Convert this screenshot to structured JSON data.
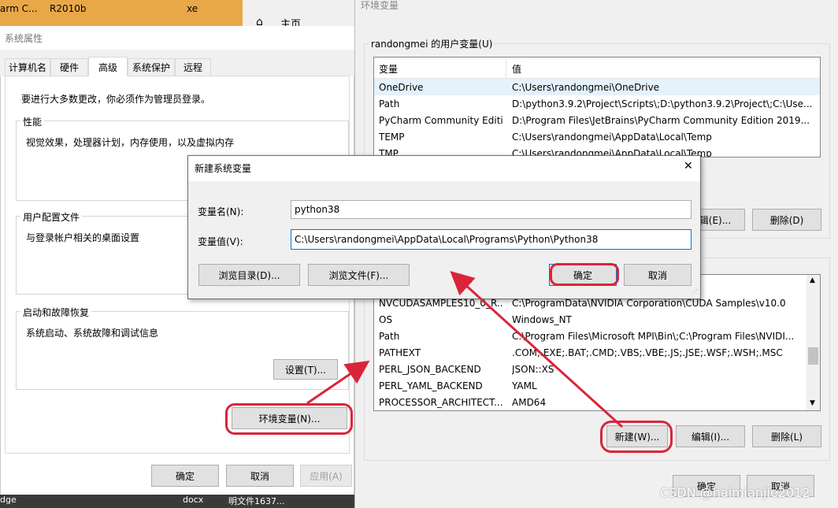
{
  "taskbar_top": {
    "item1": "arm C...",
    "item2": "R2010b",
    "item3": "xe",
    "item4": "主页"
  },
  "sys_props": {
    "title": "系统属性",
    "tabs": [
      "计算机名",
      "硬件",
      "高级",
      "系统保护",
      "远程"
    ],
    "admin_note": "要进行大多数更改，你必须作为管理员登录。",
    "perf": {
      "title": "性能",
      "desc": "视觉效果，处理器计划，内存使用，以及虚拟内存"
    },
    "profile": {
      "title": "用户配置文件",
      "desc": "与登录帐户相关的桌面设置"
    },
    "startup": {
      "title": "启动和故障恢复",
      "desc": "系统启动、系统故障和调试信息",
      "settings_btn": "设置(T)..."
    },
    "env_btn": "环境变量(N)...",
    "ok": "确定",
    "cancel": "取消",
    "apply": "应用(A)"
  },
  "env_vars": {
    "title": "环境变量",
    "user_group": "randongmei 的用户变量(U)",
    "col_var": "变量",
    "col_val": "值",
    "user_rows": [
      {
        "name": "OneDrive",
        "value": "C:\\Users\\randongmei\\OneDrive"
      },
      {
        "name": "Path",
        "value": "D:\\python3.9.2\\Project\\Scripts\\;D:\\python3.9.2\\Project\\;C:\\Use..."
      },
      {
        "name": "PyCharm Community Editi...",
        "value": "D:\\Program Files\\JetBrains\\PyCharm Community Edition 2019..."
      },
      {
        "name": "TEMP",
        "value": "C:\\Users\\randongmei\\AppData\\Local\\Temp"
      },
      {
        "name": "TMP",
        "value": "C:\\Users\\randongmei\\AppData\\Local\\Temp"
      }
    ],
    "user_edit": "编辑(E)...",
    "user_delete": "删除(D)",
    "sys_rows": [
      {
        "name": "NVCUDASAMPLES10_0_R...",
        "value": "C:\\ProgramData\\NVIDIA Corporation\\CUDA Samples\\v10.0"
      },
      {
        "name": "OS",
        "value": "Windows_NT"
      },
      {
        "name": "Path",
        "value": "C:\\Program Files\\Microsoft MPI\\Bin\\;C:\\Program Files\\NVIDI..."
      },
      {
        "name": "PATHEXT",
        "value": ".COM;.EXE;.BAT;.CMD;.VBS;.VBE;.JS;.JSE;.WSF;.WSH;.MSC"
      },
      {
        "name": "PERL_JSON_BACKEND",
        "value": "JSON::XS"
      },
      {
        "name": "PERL_YAML_BACKEND",
        "value": "YAML"
      },
      {
        "name": "PROCESSOR_ARCHITECT...",
        "value": "AMD64"
      }
    ],
    "sys_new": "新建(W)...",
    "sys_edit": "编辑(I)...",
    "sys_delete": "删除(L)",
    "ok": "确定",
    "cancel": "取消"
  },
  "new_var_dialog": {
    "title": "新建系统变量",
    "name_label": "变量名(N):",
    "name_value": "python38",
    "value_label": "变量值(V):",
    "value_value": "C:\\Users\\randongmei\\AppData\\Local\\Programs\\Python\\Python38",
    "browse_dir": "浏览目录(D)...",
    "browse_file": "浏览文件(F)...",
    "ok": "确定",
    "cancel": "取消",
    "close": "✕"
  },
  "taskbar_bottom": {
    "item1": "dge",
    "item2": "docx",
    "item3": "明文件1637..."
  },
  "watermark": "CSDN @haimianjie2012",
  "colors": {
    "annotation_red": "#d9253a",
    "selection": "#e5f1fb",
    "dialog_bg": "#f0f0f0",
    "orange_taskbar": "#e8a848"
  }
}
